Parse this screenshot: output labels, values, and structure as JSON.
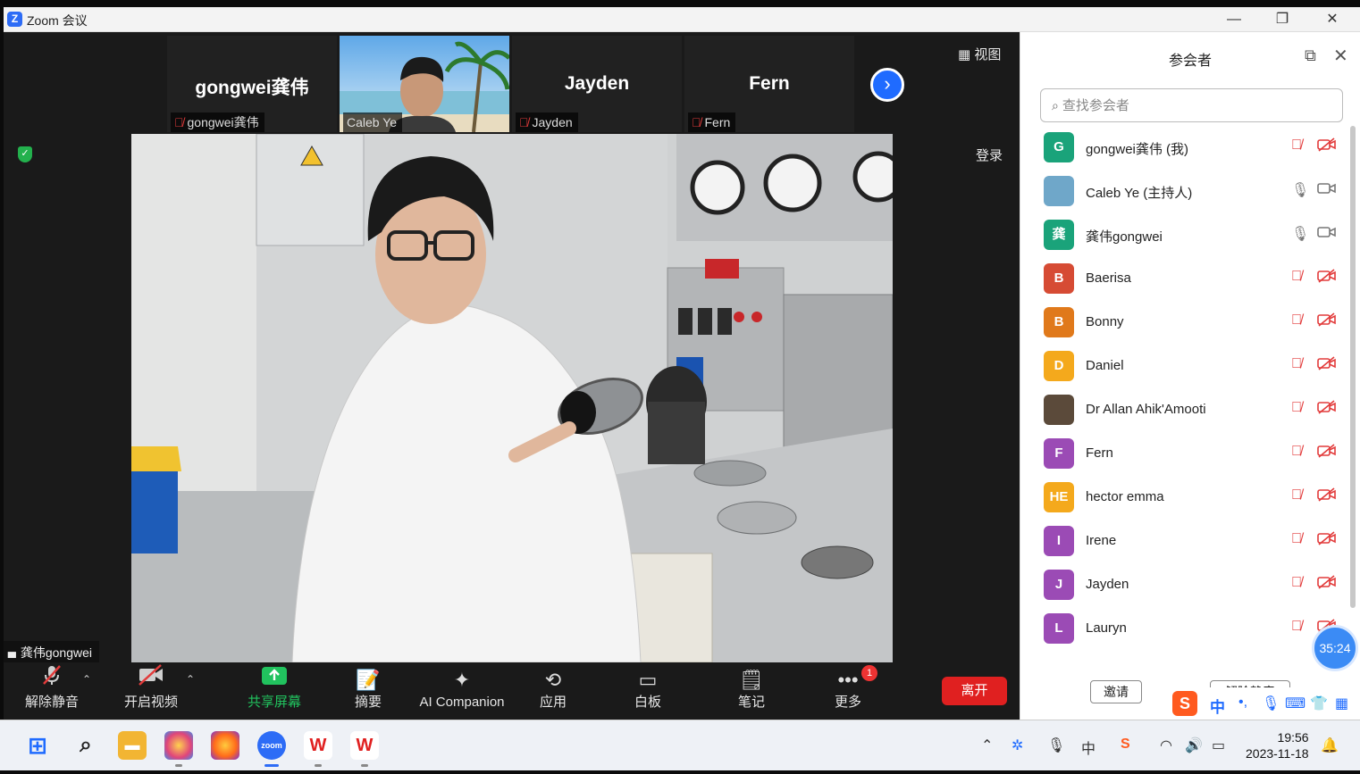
{
  "window": {
    "title": "Zoom 会议",
    "logo_letter": "Z",
    "minimize": "—",
    "maximize": "❐",
    "close": "✕"
  },
  "thumbnails": [
    {
      "name_big": "gongwei龚伟",
      "label": "gongwei龚伟",
      "muted": true
    },
    {
      "name_big": "",
      "label": "Caleb Ye",
      "muted": false,
      "video": true
    },
    {
      "name_big": "Jayden",
      "label": "Jayden",
      "muted": true
    },
    {
      "name_big": "Fern",
      "label": "Fern",
      "muted": true
    }
  ],
  "meeting": {
    "view_label": "▦ 视图",
    "record_label": "登录",
    "self_label": "龚伟gongwei",
    "signal_icon": "▮▮▮"
  },
  "toolbar": {
    "unmute": "解除静音",
    "start_video": "开启视频",
    "share_screen": "共享屏幕",
    "summary": "摘要",
    "ai_companion": "AI Companion",
    "apps": "应用",
    "whiteboard": "白板",
    "notes": "笔记",
    "more": "更多",
    "more_badge": "1",
    "leave": "离开"
  },
  "panel": {
    "title": "参会者",
    "search_placeholder": "查找参会者",
    "invite": "邀请",
    "unmute_all": "解除静音",
    "participants": [
      {
        "initial": "G",
        "name": "gongwei龚伟 (我)",
        "color": "#1aa37a",
        "mic_muted": true,
        "cam_off": true
      },
      {
        "initial": "",
        "name": "Caleb Ye (主持人)",
        "color": "#6fa7c9",
        "mic_muted": false,
        "cam_off": false,
        "avatar_icon": "photo"
      },
      {
        "initial": "龚",
        "name": "龚伟gongwei",
        "color": "#1aa37a",
        "mic_muted": false,
        "cam_off": false
      },
      {
        "initial": "B",
        "name": "Baerisa",
        "color": "#d64b34",
        "mic_muted": true,
        "cam_off": true
      },
      {
        "initial": "B",
        "name": "Bonny",
        "color": "#e0791b",
        "mic_muted": true,
        "cam_off": true
      },
      {
        "initial": "D",
        "name": "Daniel",
        "color": "#f4a91c",
        "mic_muted": true,
        "cam_off": true
      },
      {
        "initial": "",
        "name": "Dr Allan Ahik'Amooti",
        "color": "#5b4a3a",
        "mic_muted": true,
        "cam_off": true,
        "avatar_icon": "cartoon"
      },
      {
        "initial": "F",
        "name": "Fern",
        "color": "#9b4bb5",
        "mic_muted": true,
        "cam_off": true
      },
      {
        "initial": "HE",
        "name": "hector emma",
        "color": "#f4a91c",
        "mic_muted": true,
        "cam_off": true
      },
      {
        "initial": "I",
        "name": "Irene",
        "color": "#9b4bb5",
        "mic_muted": true,
        "cam_off": true
      },
      {
        "initial": "J",
        "name": "Jayden",
        "color": "#9b4bb5",
        "mic_muted": true,
        "cam_off": true
      },
      {
        "initial": "L",
        "name": "Lauryn",
        "color": "#9b4bb5",
        "mic_muted": true,
        "cam_off": true
      }
    ]
  },
  "timer": "35:24",
  "ime": {
    "logo": "S",
    "lang": "中"
  },
  "taskbar": {
    "time": "19:56",
    "date": "2023-11-18",
    "tray_lang": "中"
  }
}
